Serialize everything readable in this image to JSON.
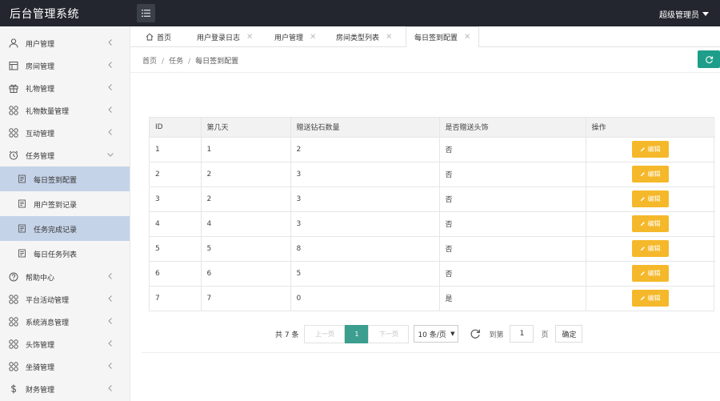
{
  "app": {
    "title": "后台管理系统",
    "user": "超级管理员"
  },
  "sidebar": {
    "items": [
      {
        "label": "用户管理",
        "icon": "user-icon"
      },
      {
        "label": "房间管理",
        "icon": "room-icon"
      },
      {
        "label": "礼物管理",
        "icon": "gift-icon"
      },
      {
        "label": "礼物数量管理",
        "icon": "grid-icon"
      },
      {
        "label": "互动管理",
        "icon": "grid-icon"
      },
      {
        "label": "任务管理",
        "icon": "clock-icon"
      },
      {
        "label": "帮助中心",
        "icon": "help-icon"
      },
      {
        "label": "平台活动管理",
        "icon": "grid-icon"
      },
      {
        "label": "系统消息管理",
        "icon": "grid-icon"
      },
      {
        "label": "头饰管理",
        "icon": "grid-icon"
      },
      {
        "label": "坐骑管理",
        "icon": "grid-icon"
      },
      {
        "label": "财务管理",
        "icon": "dollar-icon"
      }
    ],
    "task_subitems": [
      {
        "label": "每日签到配置"
      },
      {
        "label": "用户签到记录"
      },
      {
        "label": "任务完成记录"
      },
      {
        "label": "每日任务列表"
      }
    ]
  },
  "tabs": [
    {
      "label": "首页"
    },
    {
      "label": "用户登录日志"
    },
    {
      "label": "用户管理"
    },
    {
      "label": "房间类型列表"
    },
    {
      "label": "每日签到配置"
    }
  ],
  "breadcrumb": {
    "home": "首页",
    "section": "任务",
    "current": "每日签到配置",
    "sep": "/"
  },
  "table": {
    "headers": [
      "ID",
      "第几天",
      "赠送钻石数量",
      "是否赠送头饰",
      "操作"
    ],
    "edit_label": "编辑",
    "rows": [
      [
        "1",
        "1",
        "2",
        "否"
      ],
      [
        "2",
        "2",
        "3",
        "否"
      ],
      [
        "3",
        "2",
        "3",
        "否"
      ],
      [
        "4",
        "4",
        "3",
        "否"
      ],
      [
        "5",
        "5",
        "8",
        "否"
      ],
      [
        "6",
        "6",
        "5",
        "否"
      ],
      [
        "7",
        "7",
        "0",
        "是"
      ]
    ]
  },
  "pagination": {
    "total": "共 7 条",
    "prev": "上一页",
    "current": "1",
    "next": "下一页",
    "page_size": "10 条/页",
    "goto": "到第",
    "goto_value": "1",
    "unit": "页",
    "confirm": "确定"
  },
  "colors": {
    "accent": "#3b9e8e",
    "edit": "#f5b82a",
    "topbar": "#23262e",
    "active_sub": "#c5d3e8"
  }
}
